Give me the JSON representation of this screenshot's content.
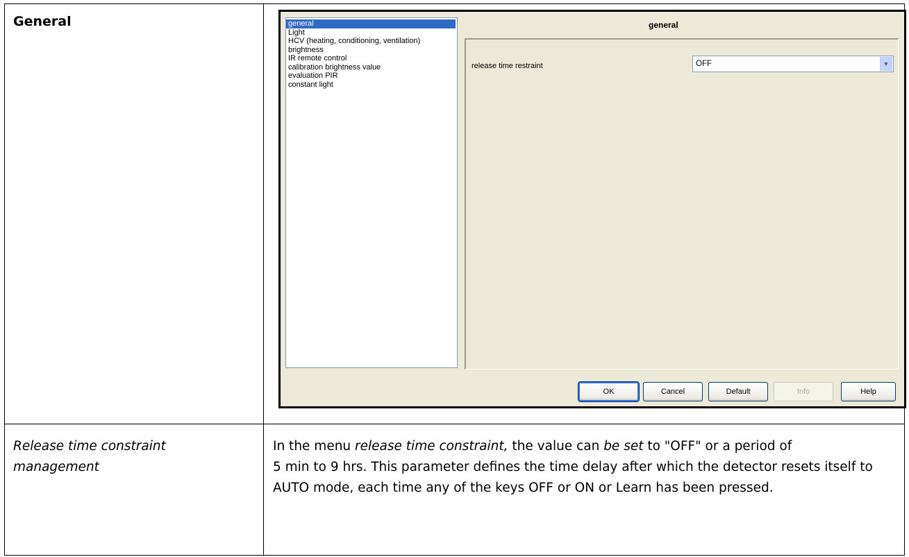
{
  "section": {
    "title": "General"
  },
  "dialog": {
    "tree_items": [
      "general",
      "Light",
      "HCV (heating, conditioning, ventilation)",
      "brightness",
      "IR remote control",
      "calibration brightness value",
      "evaluation PIR",
      "constant light"
    ],
    "selected_index": 0,
    "page_title": "general",
    "parameter_label": "release time restraint",
    "parameter_value": "OFF",
    "buttons": {
      "ok": "OK",
      "cancel": "Cancel",
      "default": "Default",
      "info": "Info",
      "help": "Help"
    }
  },
  "parameter": {
    "name": "Release time constraint management",
    "description": {
      "p1_a": "In the menu ",
      "p1_em1": "release time constraint,",
      "p1_b": " the value can ",
      "p1_em2": "be set",
      "p1_c": " to \"OFF\" or a period of",
      "p2": "5 min to 9 hrs. This parameter defines the time delay after which the detector resets itself to AUTO mode, each time any of the keys OFF or ON or Learn has been pressed."
    }
  }
}
